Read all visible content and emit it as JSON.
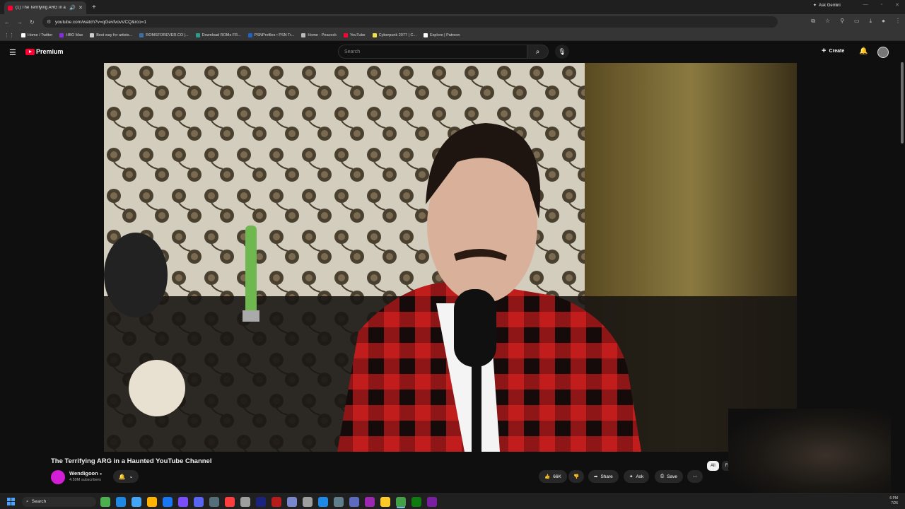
{
  "browser": {
    "tab_title": "(1) The Terrifying ARG in a Haunted YouTube Channel",
    "tab_title_short": "(1) The Terrifying ARG in a",
    "gemini_label": "Ask Gemini",
    "url": "youtube.com/watch?v=qGevfvovVCQ&rco=1",
    "bookmarks": [
      {
        "label": "Home / Twitter",
        "color": "#ffffff"
      },
      {
        "label": "HBO Max",
        "color": "#8a2be2"
      },
      {
        "label": "Best way for artists...",
        "color": "#cccccc"
      },
      {
        "label": "ROMSFOREVER.CO |...",
        "color": "#3a6ea5"
      },
      {
        "label": "Download ROMs FR...",
        "color": "#2a9d8f"
      },
      {
        "label": "PSNProfiles • PSN Tr...",
        "color": "#1e64c8"
      },
      {
        "label": "Home - Peacock",
        "color": "#bbbbbb"
      },
      {
        "label": "YouTube",
        "color": "#ff0033"
      },
      {
        "label": "Cyberpunk 2077 | C...",
        "color": "#f0e040"
      },
      {
        "label": "Explore | Patreon",
        "color": "#ffffff"
      }
    ]
  },
  "youtube": {
    "logo_text": "Premium",
    "search_placeholder": "Search",
    "create_label": "Create",
    "notif_count": "",
    "video": {
      "title": "The Terrifying ARG in a Haunted YouTube Channel",
      "channel": "Wendigoon",
      "subscribers": "4.59M subscribers",
      "likes": "66K",
      "share_label": "Share",
      "ask_label": "Ask",
      "save_label": "Save"
    },
    "chips": [
      "All",
      "From"
    ]
  },
  "taskbar": {
    "search_label": "Search",
    "time": "6 PM",
    "date": "7/26",
    "icon_colors": [
      "#4caf50",
      "#1e88e5",
      "#42a5f5",
      "#ffb300",
      "#1877f2",
      "#7c4dff",
      "#5865f2",
      "#546e7a",
      "#ff3d3d",
      "#9e9e9e",
      "#1a237e",
      "#b71c1c",
      "#7986cb",
      "#9e9e9e",
      "#1e88e5",
      "#607d8b",
      "#5c6bc0",
      "#9c27b0",
      "#ffca28",
      "#43a047",
      "#107c10",
      "#7b1fa2"
    ]
  },
  "colors": {
    "accent": "#ff0033",
    "channel_avatar": "#d21fd6"
  }
}
